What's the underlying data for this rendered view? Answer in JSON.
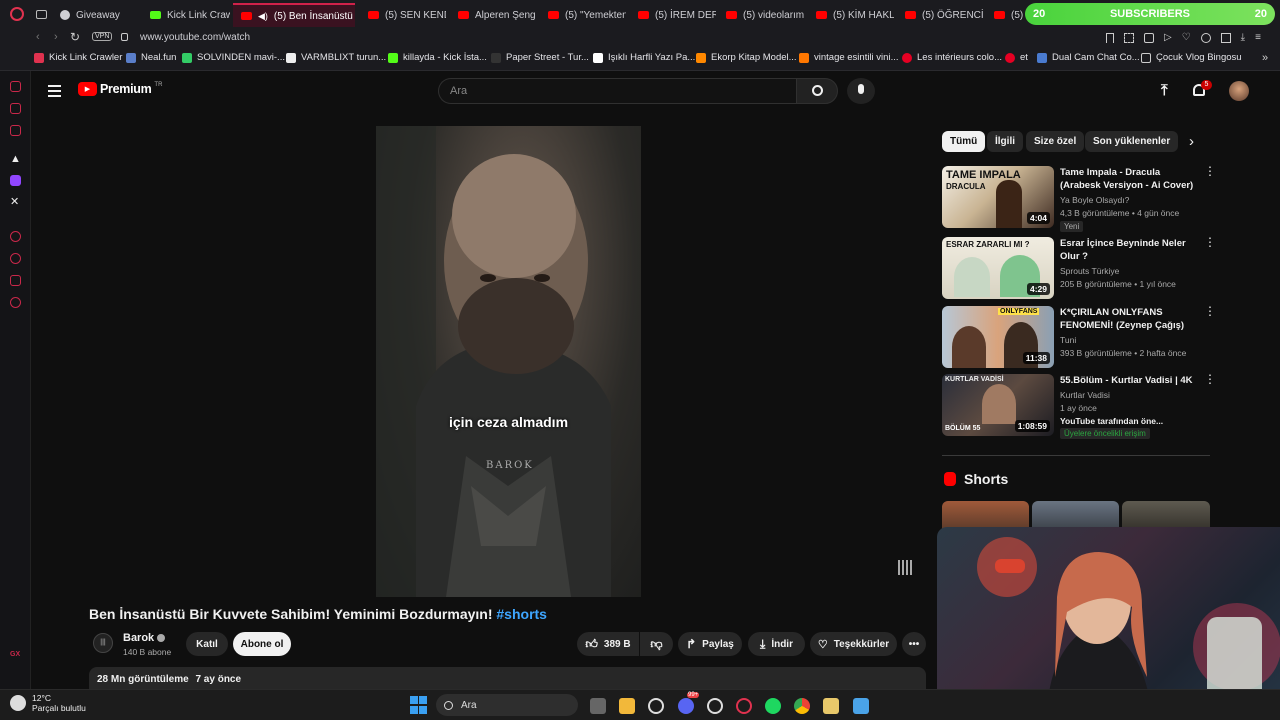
{
  "browser": {
    "tabs": [
      {
        "label": "Giveaway",
        "icon": "ghost"
      },
      {
        "label": "Kick Link Crawl",
        "icon": "kick"
      },
      {
        "label": "(5) Ben İnsanüstü Bir",
        "icon": "youtube",
        "active": true
      },
      {
        "label": "(5) SEN KENDİ",
        "icon": "youtube"
      },
      {
        "label": "Alperen Şengu",
        "icon": "youtube"
      },
      {
        "label": "(5) \"Yemekten",
        "icon": "youtube"
      },
      {
        "label": "(5) İREM DERİC",
        "icon": "youtube"
      },
      {
        "label": "(5) videolarımı",
        "icon": "youtube"
      },
      {
        "label": "(5) KİM HAKLI",
        "icon": "youtube"
      },
      {
        "label": "(5) ÖĞRENCİ E",
        "icon": "youtube"
      },
      {
        "label": "(5) E",
        "icon": "youtube"
      }
    ],
    "subscribers_widget": {
      "left": "20",
      "label": "SUBSCRIBERS",
      "right": "20"
    },
    "address": {
      "vpn": "VPN",
      "url": "www.youtube.com/watch"
    },
    "bookmarks": [
      "Kick Link Crawler",
      "Neal.fun",
      "SOLVINDEN mavi-...",
      "VARMBLIXT turun...",
      "killayda - Kick İsta...",
      "Paper Street - Tur...",
      "Işıklı Harfli Yazı Pa...",
      "Ekorp Kitap Model...",
      "vintage esintili vini...",
      "Les intérieurs colo...",
      "et",
      "Dual Cam Chat Co...",
      "Çocuk Vlog Bingosu"
    ]
  },
  "youtube": {
    "logo": "Premium",
    "logo_region": "TR",
    "search_placeholder": "Ara",
    "notification_count": "5",
    "video": {
      "caption": "için ceza almadım",
      "watermark": "BAROK",
      "title": "Ben İnsanüstü Bir Kuvvete Sahibim! Yeminimi Bozdurmayın!",
      "hashtag": "#shorts"
    },
    "channel": {
      "name": "Barok",
      "subscribers": "140 B abone",
      "join_label": "Katıl",
      "subscribe_label": "Abone ol"
    },
    "actions": {
      "likes": "389 B",
      "share": "Paylaş",
      "download": "İndir",
      "thanks": "Teşekkürler",
      "more": "•••"
    },
    "description": {
      "views": "28 Mn görüntüleme",
      "age": "7 ay önce"
    },
    "chips": [
      "Tümü",
      "İlgili",
      "Size özel",
      "Son yüklenenler"
    ],
    "recommendations": [
      {
        "title": "Tame Impala - Dracula (Arabesk Versiyon - Ai Cover)",
        "channel": "Ya Boyle Olsaydı?",
        "meta": "4,3 B görüntüleme • 4 gün önce",
        "badge": "Yeni",
        "duration": "4:04",
        "thumb_text": "TAME IMPALA",
        "thumb_sub": "DRACULA"
      },
      {
        "title": "Esrar İçince Beyninde Neler Olur ?",
        "channel": "Sprouts Türkiye",
        "meta": "205 B görüntüleme • 1 yıl önce",
        "duration": "4:29",
        "thumb_text": "ESRAR ZARARLI MI ?"
      },
      {
        "title": "K*ÇIRILAN ONLYFANS FENOMENİ! (Zeynep Çağış)",
        "channel": "Tuni",
        "meta": "393 B görüntüleme • 2 hafta önce",
        "duration": "11:38",
        "thumb_text": "ONLYFANS"
      },
      {
        "title": "55.Bölüm - Kurtlar Vadisi | 4K",
        "channel": "Kurtlar Vadisi",
        "meta": "1 ay önce",
        "extra": "YouTube tarafından öne...",
        "badge": "Üyelere öncelikli erişim",
        "duration": "1:08:59",
        "thumb_text": "KURTLAR VADİSİ",
        "thumb_sub": "BÖLÜM 55"
      }
    ],
    "shorts_heading": "Shorts"
  },
  "taskbar": {
    "weather_temp": "12°C",
    "weather_text": "Parçalı bulutlu",
    "search_placeholder": "Ara",
    "discord_badge": "99+"
  },
  "colors": {
    "accent": "#ff0000",
    "link": "#3ea6ff",
    "background": "#0f0f0f",
    "surface": "#272727",
    "opera_red": "#d0224a",
    "sub_green": "#5cd646"
  }
}
